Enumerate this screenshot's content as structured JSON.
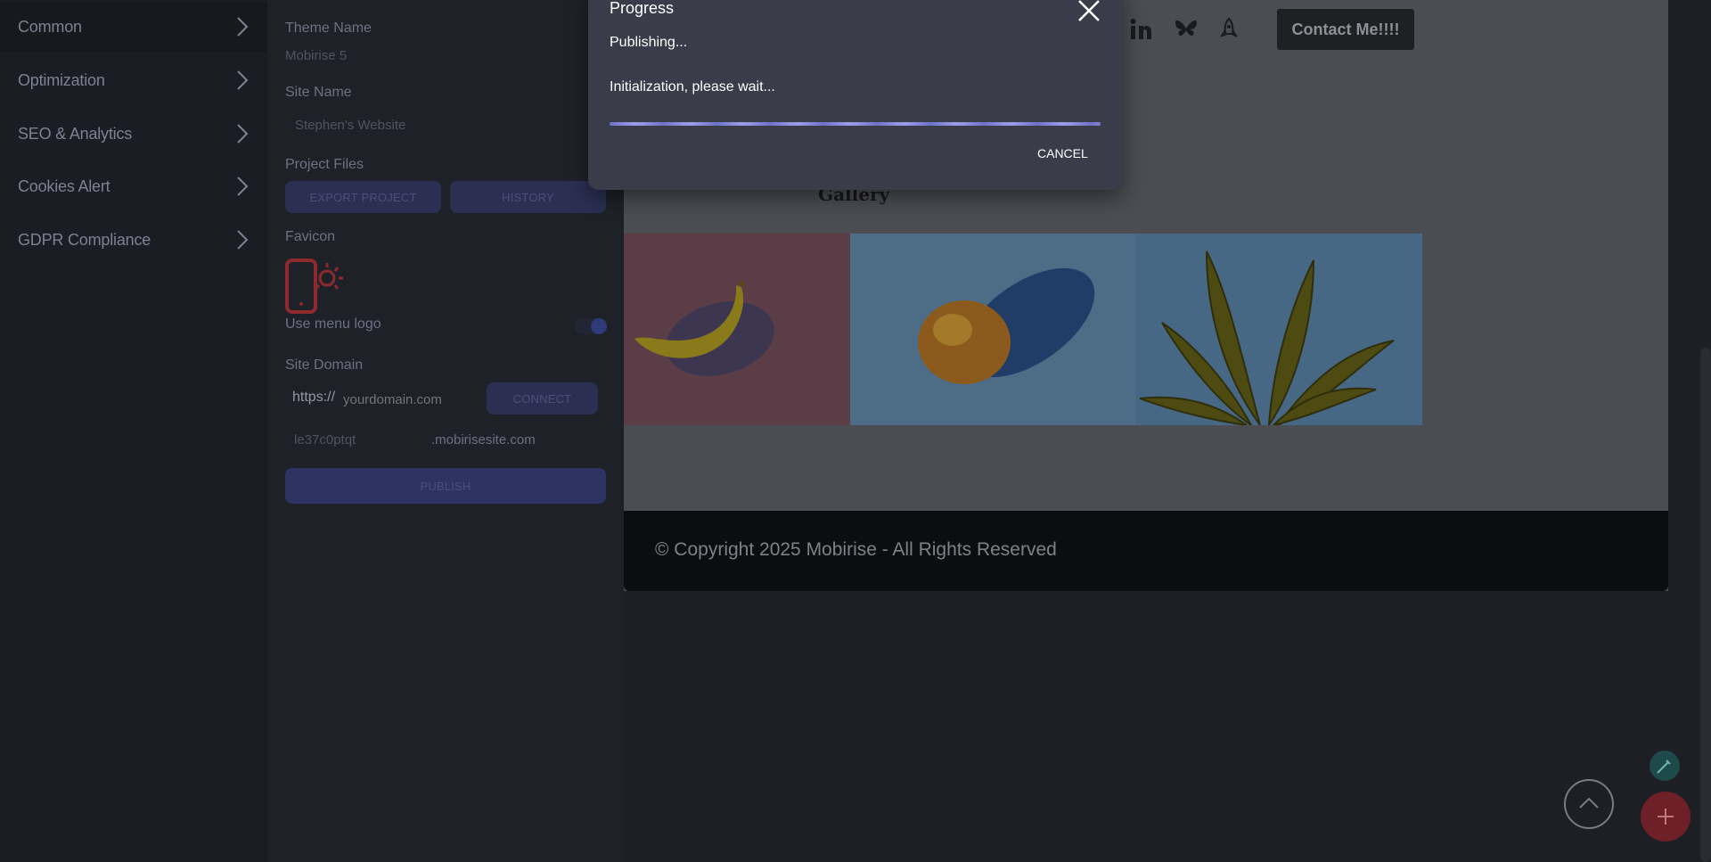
{
  "menu": {
    "items": [
      {
        "label": "Common"
      },
      {
        "label": "Optimization"
      },
      {
        "label": "SEO & Analytics"
      },
      {
        "label": "Cookies Alert"
      },
      {
        "label": "GDPR Compliance"
      }
    ]
  },
  "panel": {
    "theme_name_label": "Theme Name",
    "theme_name_value": "Mobirise 5",
    "site_name_label": "Site Name",
    "site_name_value": "Stephen's Website",
    "project_files_label": "Project Files",
    "export_button": "EXPORT PROJECT",
    "history_button": "HISTORY",
    "favicon_label": "Favicon",
    "menu_logo_label": "Use menu logo",
    "menu_logo_enabled": true,
    "site_domain_label": "Site Domain",
    "domain_prefix": "https://",
    "domain_placeholder": "yourdomain.com",
    "connect_button": "CONNECT",
    "subdomain_value": "le37c0ptqt",
    "subdomain_suffix": ".mobirisesite.com",
    "publish_button": "PUBLISH"
  },
  "site": {
    "gallery_title": "Gallery",
    "contact_button": "Contact Me!!!!",
    "copyright": "© Copyright 2025 Mobirise - All Rights Reserved",
    "social_icons": [
      "linkedin-icon",
      "bluesky-icon",
      "rocket-icon"
    ]
  },
  "dialog": {
    "title": "Progress",
    "status": "Publishing...",
    "message": "Initialization, please wait...",
    "progress": 1.0,
    "cancel_button": "CANCEL"
  },
  "colors": {
    "accent": "#4a55c7",
    "dialog_bg": "#3a3c4a",
    "fab_add": "#c0303b",
    "fab_edit": "#2a8d8e"
  }
}
